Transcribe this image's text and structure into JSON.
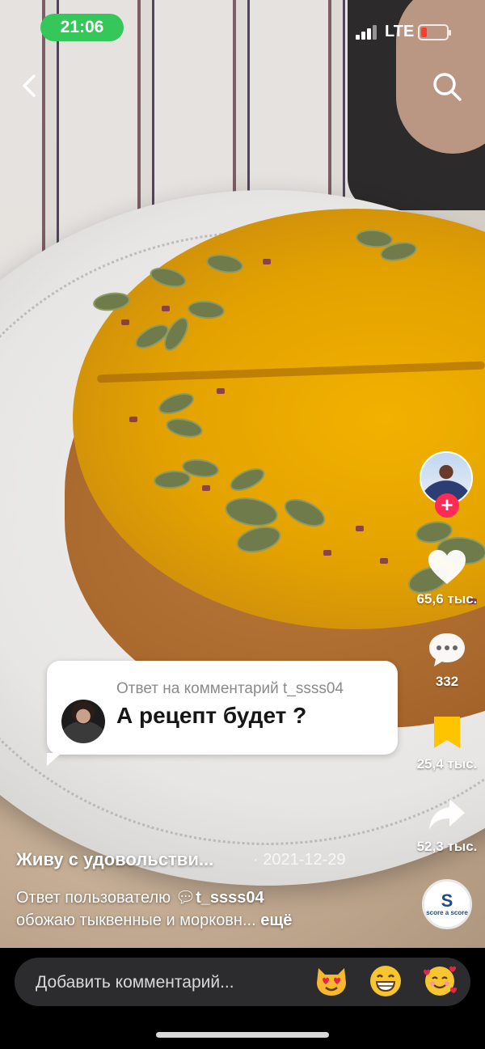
{
  "status_bar": {
    "time": "21:06",
    "network": "LTE",
    "battery_level": 0.2,
    "time_pill_color": "#35c759",
    "battery_color": "#ff3b30"
  },
  "nav": {
    "back_icon": "chevron-left-icon",
    "search_icon": "search-icon"
  },
  "actions": {
    "likes": "65,6 тыс.",
    "comments": "332",
    "favorites": "25,4 тыс.",
    "shares": "52,3 тыс.",
    "favorite_color": "#ffc400",
    "follow_color": "#fe2c55"
  },
  "reply": {
    "header": "Ответ на комментарий t_ssss04",
    "text": "А рецепт будет ?"
  },
  "caption": {
    "author": "Живу с удовольстви...",
    "date": "· 2021-12-29",
    "reply_prefix": "Ответ пользователю",
    "reply_user": "t_ssss04",
    "description": "обожаю тыквенные и морковн...",
    "more": "ещё"
  },
  "sound": {
    "logo_letter": "S",
    "logo_text": "score a score"
  },
  "comment_bar": {
    "placeholder": "Добавить комментарий...",
    "emojis": [
      "heart-eyes-cat-icon",
      "grinning-face-icon",
      "smiling-face-with-hearts-icon"
    ]
  }
}
